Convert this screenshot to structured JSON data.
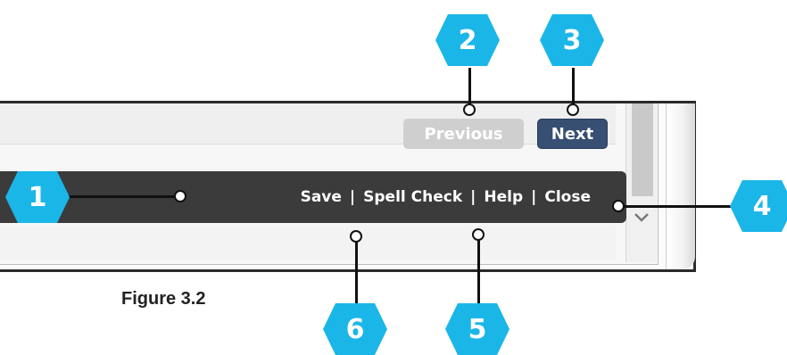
{
  "buttons": {
    "previous": "Previous",
    "next": "Next"
  },
  "toolbar": {
    "save": "Save",
    "spell_check": "Spell Check",
    "help": "Help",
    "close": "Close",
    "separator": "|"
  },
  "caption": "Figure 3.2",
  "callouts": {
    "c1": "1",
    "c2": "2",
    "c3": "3",
    "c4": "4",
    "c5": "5",
    "c6": "6"
  },
  "colors": {
    "callout": "#1bb6e8",
    "toolbar_bg": "#3b3b3b",
    "next_button": "#364f72",
    "previous_button_disabled": "#cfcfcf"
  },
  "icons": {
    "scroll_down": "chevron-down-icon"
  }
}
